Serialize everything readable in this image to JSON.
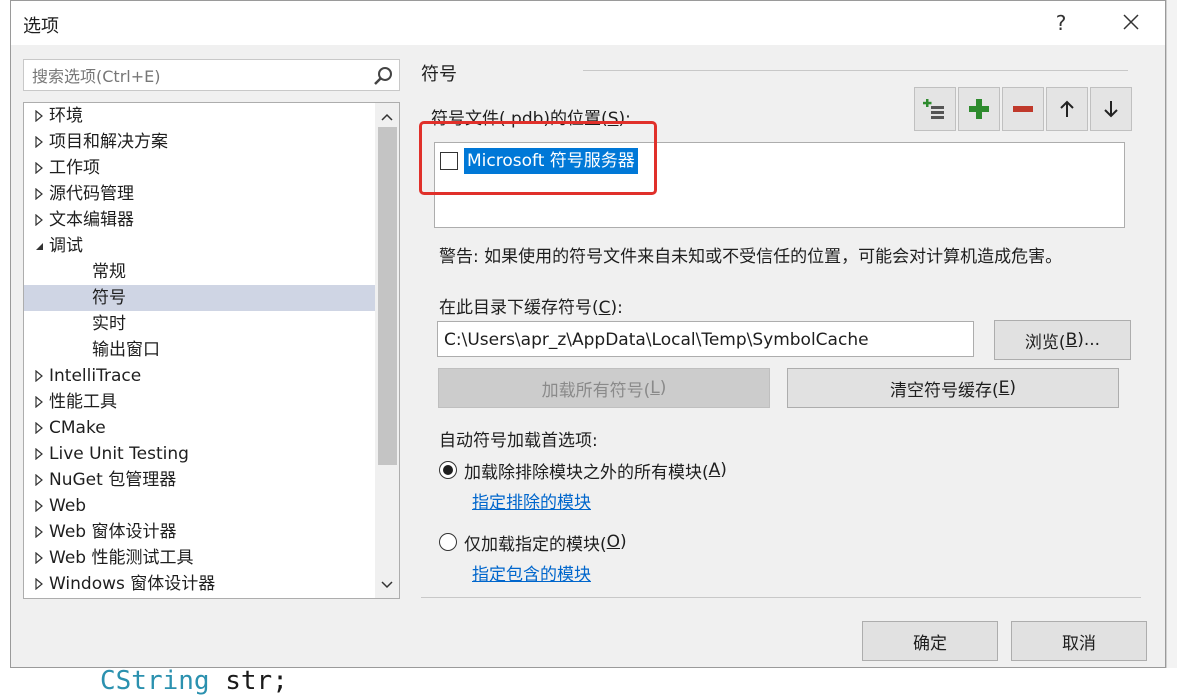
{
  "dialog": {
    "title": "选项",
    "help_glyph": "?",
    "close_icon": "close-icon"
  },
  "search": {
    "placeholder": "搜索选项(Ctrl+E)"
  },
  "tree": {
    "items": [
      {
        "label": "环境",
        "level": 0,
        "state": "collapsed"
      },
      {
        "label": "项目和解决方案",
        "level": 0,
        "state": "collapsed"
      },
      {
        "label": "工作项",
        "level": 0,
        "state": "collapsed"
      },
      {
        "label": "源代码管理",
        "level": 0,
        "state": "collapsed"
      },
      {
        "label": "文本编辑器",
        "level": 0,
        "state": "collapsed"
      },
      {
        "label": "调试",
        "level": 0,
        "state": "expanded"
      },
      {
        "label": "常规",
        "level": 1,
        "state": "leaf"
      },
      {
        "label": "符号",
        "level": 1,
        "state": "leaf",
        "selected": true
      },
      {
        "label": "实时",
        "level": 1,
        "state": "leaf"
      },
      {
        "label": "输出窗口",
        "level": 1,
        "state": "leaf"
      },
      {
        "label": "IntelliTrace",
        "level": 0,
        "state": "collapsed"
      },
      {
        "label": "性能工具",
        "level": 0,
        "state": "collapsed"
      },
      {
        "label": "CMake",
        "level": 0,
        "state": "collapsed"
      },
      {
        "label": "Live Unit Testing",
        "level": 0,
        "state": "collapsed"
      },
      {
        "label": "NuGet 包管理器",
        "level": 0,
        "state": "collapsed"
      },
      {
        "label": "Web",
        "level": 0,
        "state": "collapsed"
      },
      {
        "label": "Web 窗体设计器",
        "level": 0,
        "state": "collapsed"
      },
      {
        "label": "Web 性能测试工具",
        "level": 0,
        "state": "collapsed"
      },
      {
        "label": "Windows 窗体设计器",
        "level": 0,
        "state": "collapsed"
      }
    ]
  },
  "symbols": {
    "section_title": "符号",
    "locations_label_pre": "符号文件(.pdb)的位置(",
    "locations_label_key": "S",
    "locations_label_post": "):",
    "toolbar_icons": [
      "add-location-icon",
      "plus-icon",
      "minus-icon",
      "arrow-up-icon",
      "arrow-down-icon"
    ],
    "locations": [
      {
        "label": "Microsoft 符号服务器",
        "checked": false,
        "selected": true
      }
    ],
    "warning": "警告: 如果使用的符号文件来自未知或不受信任的位置，可能会对计算机造成危害。",
    "cache_label_pre": "在此目录下缓存符号(",
    "cache_label_key": "C",
    "cache_label_post": "):",
    "cache_path": "C:\\Users\\apr_z\\AppData\\Local\\Temp\\SymbolCache",
    "browse_pre": "浏览(",
    "browse_key": "B",
    "browse_post": ")...",
    "load_all_pre": "加载所有符号(",
    "load_all_key": "L",
    "load_all_post": ")",
    "clear_cache_pre": "清空符号缓存(",
    "clear_cache_key": "E",
    "clear_cache_post": ")",
    "auto_load_label": "自动符号加载首选项:",
    "option_all_pre": "加载除排除模块之外的所有模块(",
    "option_all_key": "A",
    "option_all_post": ")",
    "option_all_checked": true,
    "link_excluded": "指定排除的模块",
    "option_specified_pre": "仅加载指定的模块(",
    "option_specified_key": "O",
    "option_specified_post": ")",
    "option_specified_checked": false,
    "link_included": "指定包含的模块"
  },
  "footer": {
    "ok": "确定",
    "cancel": "取消"
  },
  "background": {
    "code_kw": "CString",
    "code_rest": " str;"
  },
  "colors": {
    "selection": "#0078d7",
    "highlight_box": "#e0302a",
    "link": "#0066cc",
    "tree_selected": "#cfd5e4"
  }
}
